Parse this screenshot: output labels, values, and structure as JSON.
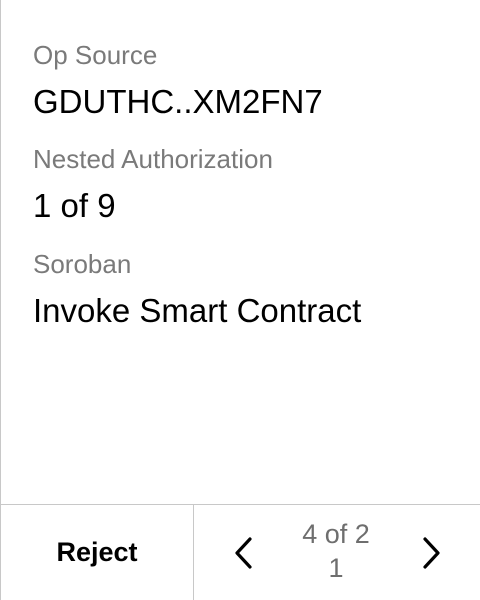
{
  "fields": [
    {
      "label": "Op Source",
      "value": "GDUTHC..XM2FN7"
    },
    {
      "label": "Nested Authorization",
      "value": "1 of 9"
    },
    {
      "label": "Soroban",
      "value": "Invoke Smart Contract"
    }
  ],
  "footer": {
    "reject_label": "Reject",
    "pager_line1": "4 of 2",
    "pager_line2": "1",
    "prev_icon": "chevron-left-icon",
    "next_icon": "chevron-right-icon"
  }
}
